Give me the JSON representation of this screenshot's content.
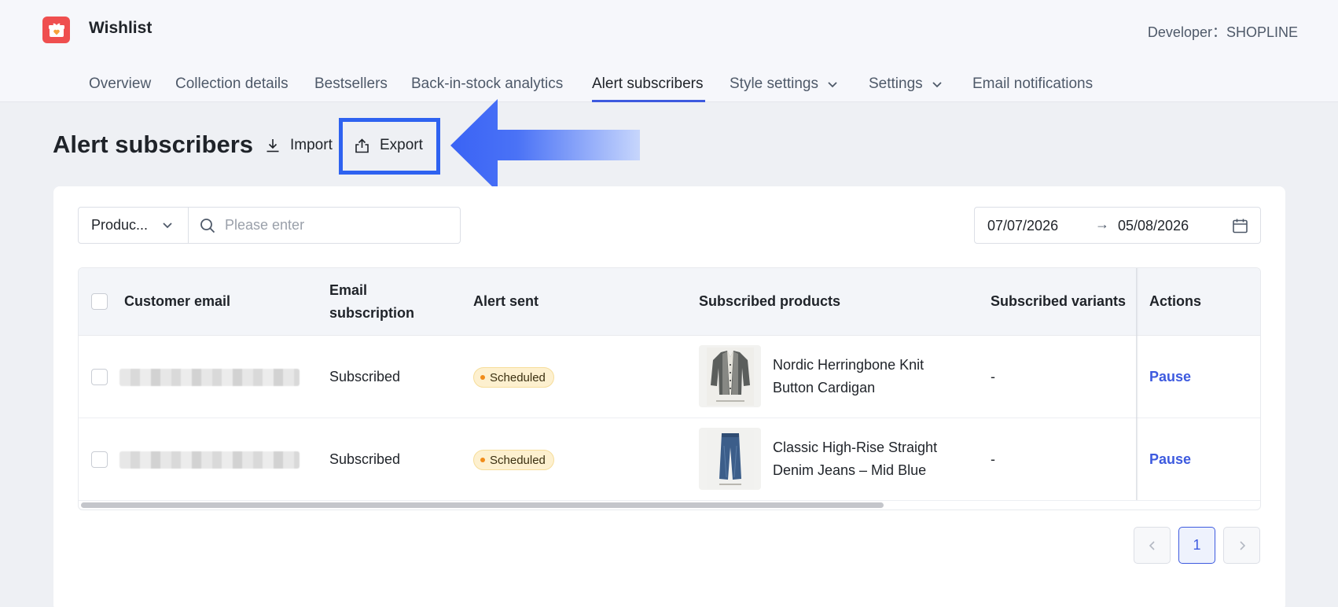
{
  "app": {
    "title": "Wishlist",
    "developer": "Developer：SHOPLINE",
    "logo_icon": "gift-heart-icon",
    "brand_color": "#ef4f4f"
  },
  "nav": {
    "items": [
      {
        "label": "Overview"
      },
      {
        "label": "Collection details"
      },
      {
        "label": "Bestsellers"
      },
      {
        "label": "Back-in-stock analytics"
      },
      {
        "label": "Alert subscribers",
        "active": true
      },
      {
        "label": "Style settings",
        "dropdown": true
      },
      {
        "label": "Settings",
        "dropdown": true
      },
      {
        "label": "Email notifications"
      }
    ],
    "accent_color": "#3d5adf"
  },
  "page": {
    "title": "Alert subscribers",
    "import_label": "Import",
    "export_label": "Export",
    "highlight_color": "#2e62f0"
  },
  "filters": {
    "field_select": "Produc...",
    "search_placeholder": "Please enter",
    "date_start": "07/07/2026",
    "date_sep": "→",
    "date_end": "05/08/2026"
  },
  "table": {
    "columns": [
      "Customer email",
      "Email subscription",
      "Alert sent",
      "Subscribed products",
      "Subscribed variants",
      "Actions"
    ],
    "rows": [
      {
        "email": "",
        "subscription": "Subscribed",
        "alert_status": "Scheduled",
        "product_line1": "Nordic Herringbone Knit",
        "product_line2": "Button Cardigan",
        "product_icon": "cardigan-thumbnail",
        "variants": "-",
        "action": "Pause"
      },
      {
        "email": "",
        "subscription": "Subscribed",
        "alert_status": "Scheduled",
        "product_line1": "Classic High-Rise Straight",
        "product_line2": "Denim Jeans – Mid Blue",
        "product_icon": "jeans-thumbnail",
        "variants": "-",
        "action": "Pause"
      }
    ]
  },
  "pagination": {
    "current_page": "1"
  }
}
